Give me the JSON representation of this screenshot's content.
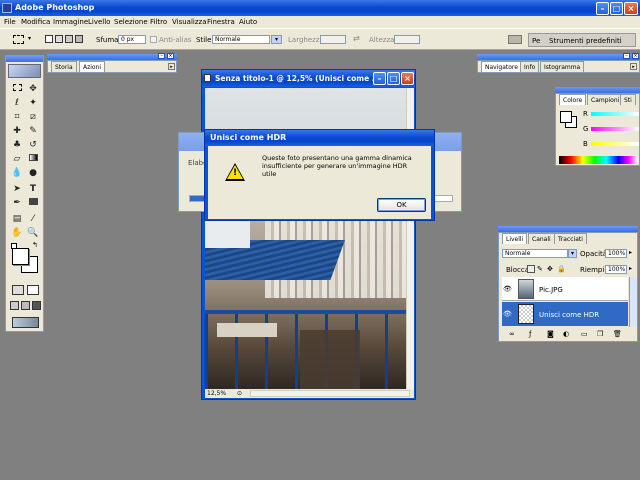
{
  "app": {
    "title": "Adobe Photoshop"
  },
  "menu": [
    "File",
    "Modifica",
    "Immagine",
    "Livello",
    "Selezione",
    "Filtro",
    "Visualizza",
    "Finestra",
    "Aiuto"
  ],
  "options_bar": {
    "sfuma_label": "Sfuma:",
    "sfuma_value": "0 px",
    "antialias_label": "Anti-alias",
    "stile_label": "Stile:",
    "stile_value": "Normale",
    "larghezza_label": "Larghezza:",
    "altezza_label": "Altezza:",
    "tool_presets": [
      "Pe",
      "Strumenti predefiniti"
    ]
  },
  "palette_storia": {
    "tabs": [
      "Storia",
      "Azioni"
    ]
  },
  "palette_navigatore": {
    "tabs": [
      "Navigatore",
      "Info",
      "Istogramma"
    ]
  },
  "palette_colore": {
    "tabs": [
      "Colore",
      "Campioni",
      "Sti"
    ],
    "channels": [
      "R",
      "G",
      "B"
    ]
  },
  "palette_livelli": {
    "tabs": [
      "Livelli",
      "Canali",
      "Tracciati"
    ],
    "blend_mode": "Normale",
    "opacity_label": "Opacità:",
    "opacity_value": "100%",
    "lock_label": "Blocca:",
    "fill_label": "Riempi:",
    "fill_value": "100%",
    "layers": [
      {
        "name": "Pic.JPG",
        "selected": false
      },
      {
        "name": "Unisci come HDR",
        "selected": true
      }
    ]
  },
  "document": {
    "title": "Senza titolo-1 @ 12,5% (Unisci come ...",
    "zoom": "12,5%"
  },
  "background_dialog": {
    "label": "Elabo"
  },
  "alert": {
    "title": "Unisci come HDR",
    "message": "Queste foto presentano una gamma dinamica insufficiente per generare un'immagine HDR utile",
    "ok_label": "OK"
  },
  "colors": {
    "desktop": "#808080",
    "xp_blue": "#0a53d9",
    "panel": "#ece9d8",
    "selection": "#316ac5"
  }
}
